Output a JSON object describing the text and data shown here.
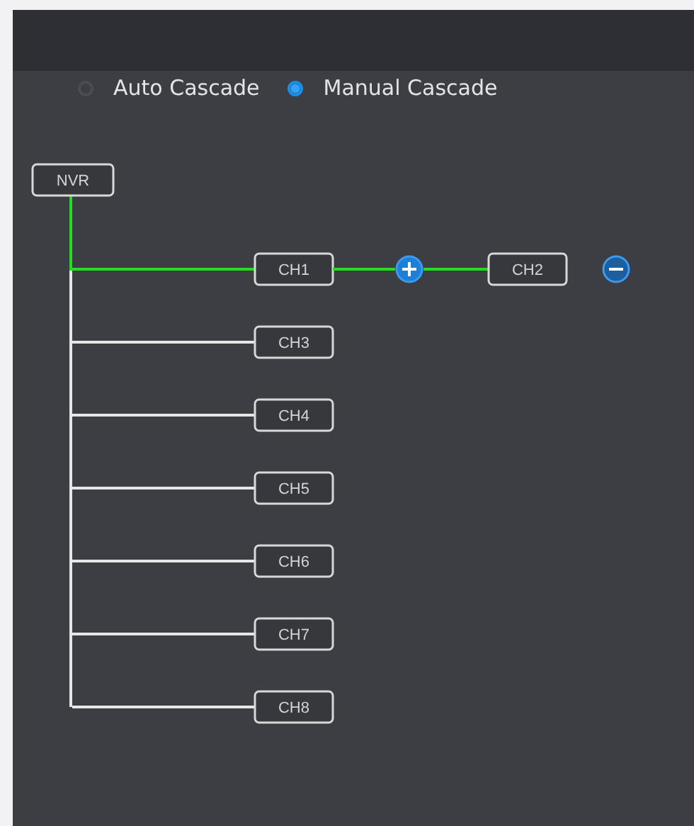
{
  "cascade_mode": [
    {
      "label": "Auto Cascade",
      "selected": false
    },
    {
      "label": "Manual Cascade",
      "selected": true
    }
  ],
  "tree": {
    "root": "NVR",
    "children": [
      {
        "label": "CH1",
        "active": true,
        "children": [
          {
            "label": "CH2"
          }
        ]
      },
      {
        "label": "CH3",
        "active": false
      },
      {
        "label": "CH4",
        "active": false
      },
      {
        "label": "CH5",
        "active": false
      },
      {
        "label": "CH6",
        "active": false
      },
      {
        "label": "CH7",
        "active": false
      },
      {
        "label": "CH8",
        "active": false
      }
    ]
  }
}
